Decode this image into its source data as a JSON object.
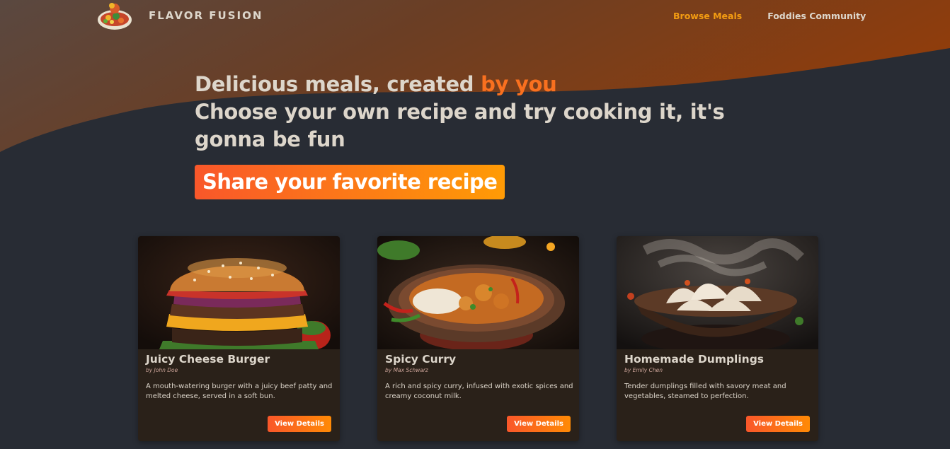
{
  "header": {
    "brand": "FLAVOR FUSION",
    "nav": [
      {
        "label": "Browse Meals",
        "active": true
      },
      {
        "label": "Foddies Community",
        "active": false
      }
    ]
  },
  "hero": {
    "line1_prefix": "Delicious meals, created ",
    "line1_highlight": "by you",
    "line2": "Choose your own recipe and try cooking it, it's gonna be fun",
    "cta": "Share your favorite recipe"
  },
  "meals": [
    {
      "title": "Juicy Cheese Burger",
      "author": "by John Doe",
      "description": "A mouth-watering burger with a juicy beef patty and melted cheese, served in a soft bun.",
      "button": "View Details",
      "image_icon": "burger-image"
    },
    {
      "title": "Spicy Curry",
      "author": "by Max Schwarz",
      "description": "A rich and spicy curry, infused with exotic spices and creamy coconut milk.",
      "button": "View Details",
      "image_icon": "curry-image"
    },
    {
      "title": "Homemade Dumplings",
      "author": "by Emily Chen",
      "description": "Tender dumplings filled with savory meat and vegetables, steamed to perfection.",
      "button": "View Details",
      "image_icon": "dumplings-image"
    }
  ],
  "colors": {
    "background": "#282c34",
    "accent": "#f9572a",
    "accent_secondary": "#ff9b05",
    "nav_active": "#f39c12",
    "text": "#ddd6cb",
    "card_bg": "#2a2119"
  }
}
